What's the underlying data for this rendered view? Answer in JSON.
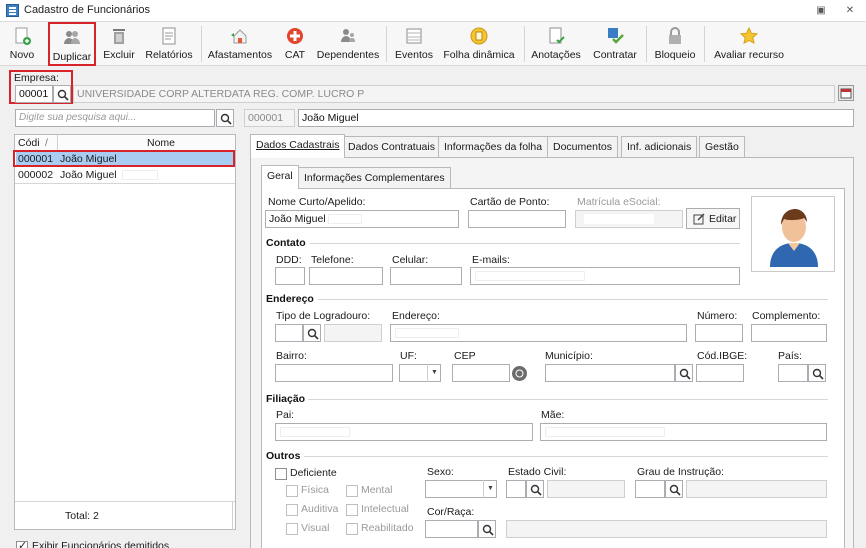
{
  "window": {
    "title": "Cadastro de Funcionários",
    "restore_glyph": "▣",
    "close_glyph": "✕"
  },
  "toolbar": [
    {
      "id": "novo",
      "label": "Novo",
      "icon": "new-user-icon"
    },
    {
      "id": "duplicar",
      "label": "Duplicar",
      "icon": "duplicate-users-icon"
    },
    {
      "id": "excluir",
      "label": "Excluir",
      "icon": "trash-icon"
    },
    {
      "id": "relatorios",
      "label": "Relatórios",
      "icon": "report-icon"
    },
    {
      "id": "afastamentos",
      "label": "Afastamentos",
      "icon": "house-leave-icon"
    },
    {
      "id": "cat",
      "label": "CAT",
      "icon": "medical-cross-icon"
    },
    {
      "id": "dependentes",
      "label": "Dependentes",
      "icon": "dependents-icon"
    },
    {
      "id": "eventos",
      "label": "Eventos",
      "icon": "events-icon"
    },
    {
      "id": "folha",
      "label": "Folha dinâmica",
      "icon": "coin-sheet-icon"
    },
    {
      "id": "anotacoes",
      "label": "Anotações",
      "icon": "notes-icon"
    },
    {
      "id": "contratar",
      "label": "Contratar",
      "icon": "hire-check-icon"
    },
    {
      "id": "bloqueio",
      "label": "Bloqueio",
      "icon": "lock-icon"
    },
    {
      "id": "avaliar",
      "label": "Avaliar recurso",
      "icon": "star-icon"
    }
  ],
  "empresa": {
    "label": "Empresa:",
    "code": "00001",
    "name": "UNIVERSIDADE CORP ALTERDATA REG. COMP. LUCRO P"
  },
  "search": {
    "placeholder": "Digite sua pesquisa aqui..."
  },
  "header_record": {
    "code": "000001",
    "name": "João Miguel"
  },
  "grid": {
    "col_code": "Códi",
    "col_sort": "/",
    "col_name": "Nome",
    "rows": [
      {
        "code": "000001",
        "name": "João Miguel"
      },
      {
        "code": "000002",
        "name": "João Miguel"
      }
    ],
    "total_label": "Total: 2",
    "show_dismissed": "Exibir Funcionários demitidos"
  },
  "tabs": [
    "Dados Cadastrais",
    "Dados Contratuais",
    "Informações da folha",
    "Documentos",
    "Inf. adicionais",
    "Gestão"
  ],
  "subtabs": [
    "Geral",
    "Informações Complementares"
  ],
  "form": {
    "nome_curto_label": "Nome Curto/Apelido:",
    "nome_curto_value": "João Miguel",
    "cartao_label": "Cartão de Ponto:",
    "matricula_label": "Matrícula eSocial:",
    "editar": "Editar",
    "contato": "Contato",
    "ddd": "DDD:",
    "telefone": "Telefone:",
    "celular": "Celular:",
    "emails": "E-mails:",
    "endereco_section": "Endereço",
    "tipo_logradouro": "Tipo de Logradouro:",
    "endereco": "Endereço:",
    "numero": "Número:",
    "complemento": "Complemento:",
    "bairro": "Bairro:",
    "uf": "UF:",
    "cep": "CEP",
    "municipio": "Município:",
    "cod_ibge": "Cód.IBGE:",
    "pais": "País:",
    "filiacao": "Filiação",
    "pai": "Pai:",
    "mae": "Mãe:",
    "outros": "Outros",
    "deficiente": "Deficiente",
    "fisica": "Física",
    "mental": "Mental",
    "auditiva": "Auditiva",
    "intelectual": "Intelectual",
    "visual": "Visual",
    "reabilitado": "Reabilitado",
    "sexo": "Sexo:",
    "estado_civil": "Estado Civil:",
    "grau_instrucao": "Grau de Instrução:",
    "cor_raca": "Cor/Raça:"
  },
  "colors": {
    "accent_red": "#d8232a",
    "selection": "#a9cdf2"
  }
}
